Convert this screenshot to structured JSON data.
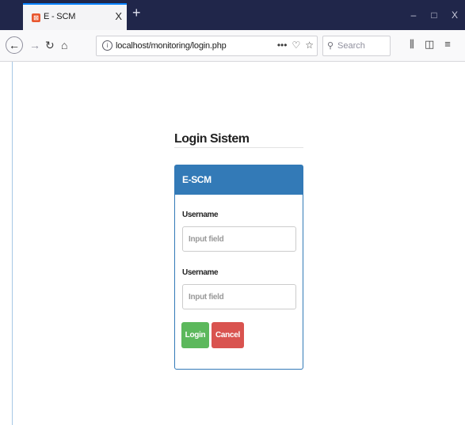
{
  "browser": {
    "tab": {
      "title": "E - SCM",
      "close_glyph": "X",
      "favicon": "scm-favicon-icon"
    },
    "new_tab_glyph": "+",
    "window_controls": {
      "minimize": "–",
      "maximize": "□",
      "close": "X"
    },
    "nav": {
      "back_icon": "back-arrow-icon",
      "forward_icon": "forward-arrow-icon",
      "reload_icon": "reload-icon",
      "home_icon": "home-icon"
    },
    "url": "localhost/monitoring/login.php",
    "url_actions": {
      "more": "•••",
      "pocket": "pocket-icon",
      "bookmark": "star-icon"
    },
    "search": {
      "placeholder": "Search"
    },
    "toolbar": {
      "library": "library-icon",
      "sidebar": "sidebar-icon",
      "menu": "hamburger-menu-icon"
    }
  },
  "page": {
    "title": "Login Sistem",
    "panel": {
      "heading": "E-SCM",
      "fields": [
        {
          "label": "Username",
          "placeholder": "Input field"
        },
        {
          "label": "Username",
          "placeholder": "Input field"
        }
      ],
      "buttons": {
        "login": "Login",
        "cancel": "Cancel"
      }
    }
  },
  "colors": {
    "titlebar": "#20264a",
    "panel_primary": "#337ab7",
    "btn_login": "#5cb85c",
    "btn_cancel": "#d9534f"
  }
}
